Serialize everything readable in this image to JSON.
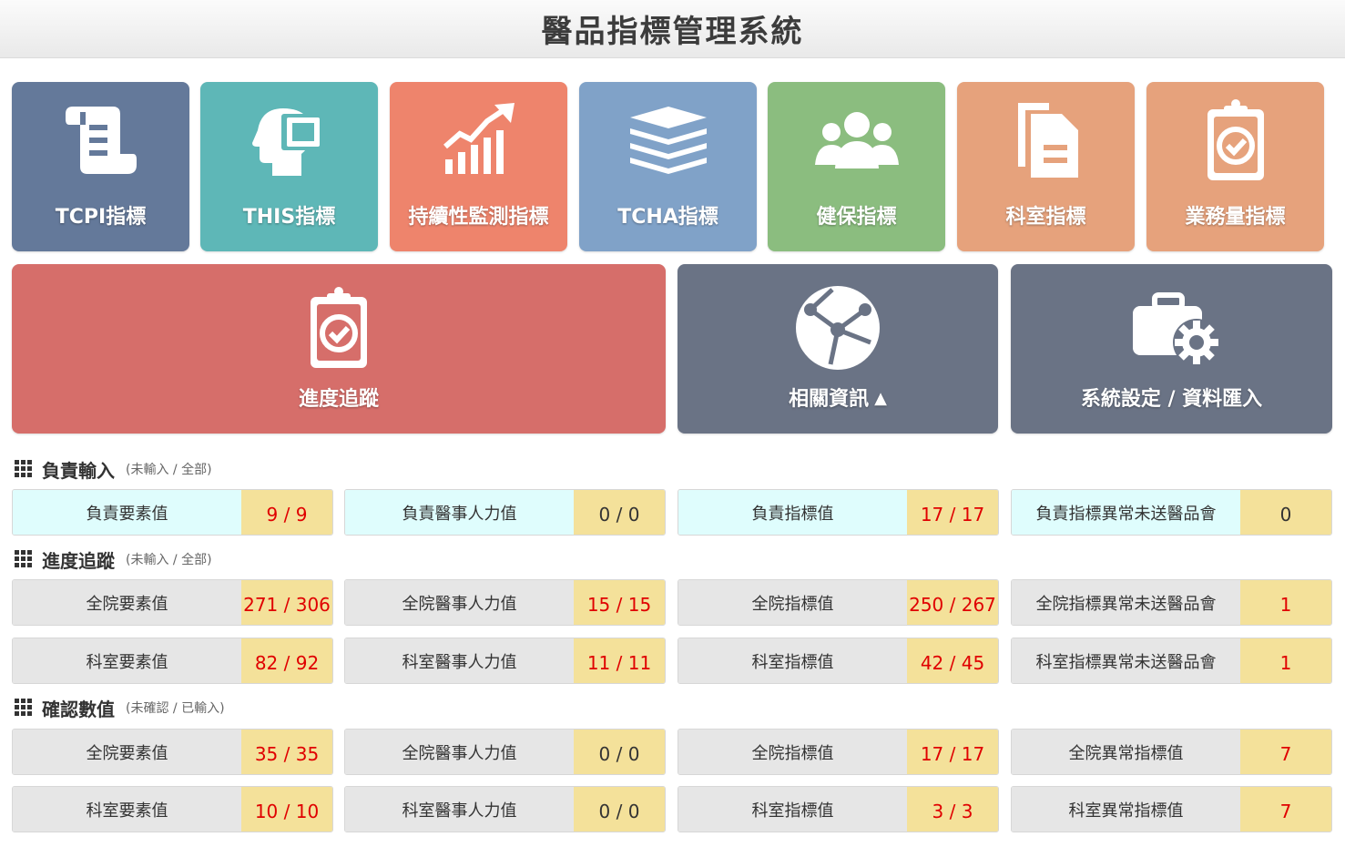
{
  "header": {
    "title": "醫品指標管理系統"
  },
  "tiles": {
    "tcpi": {
      "label": "TCPI指標",
      "color": "#64799a",
      "icon": "scroll-icon"
    },
    "this": {
      "label": "THIS指標",
      "color": "#5eb7b7",
      "icon": "head-profile-icon"
    },
    "sustain": {
      "label": "持續性監測指標",
      "color": "#ee846c",
      "icon": "chart-line-icon"
    },
    "tcha": {
      "label": "TCHA指標",
      "color": "#80a2c8",
      "icon": "layers-icon"
    },
    "nhi": {
      "label": "健保指標",
      "color": "#8bbd7f",
      "icon": "users-icon"
    },
    "dept": {
      "label": "科室指標",
      "color": "#e6a27c",
      "icon": "copy-file-icon"
    },
    "workload": {
      "label": "業務量指標",
      "color": "#e6a27c",
      "icon": "clipboard-check-icon"
    },
    "progress": {
      "label": "進度追蹤",
      "color": "#d66e6a",
      "icon": "clipboard-check-icon"
    },
    "related": {
      "label": "相關資訊",
      "color": "#6a7385",
      "icon": "globe-network-icon"
    },
    "settings": {
      "label": "系統設定 / 資料匯入",
      "color": "#6a7385",
      "icon": "briefcase-gear-icon"
    }
  },
  "sections": {
    "responsible": {
      "title": "負責輸入",
      "sub": "(未輸入 / 全部)",
      "items": [
        {
          "name": "負責要素值",
          "value": "9 / 9"
        },
        {
          "name": "負責醫事人力值",
          "value": "0 / 0"
        },
        {
          "name": "負責指標值",
          "value": "17 / 17"
        },
        {
          "name": "負責指標異常未送醫品會",
          "value": "0"
        }
      ]
    },
    "progress": {
      "title": "進度追蹤",
      "sub": "(未輸入 / 全部)",
      "items": [
        {
          "name": "全院要素值",
          "value": "271 / 306"
        },
        {
          "name": "全院醫事人力值",
          "value": "15 / 15"
        },
        {
          "name": "全院指標值",
          "value": "250 / 267"
        },
        {
          "name": "全院指標異常未送醫品會",
          "value": "1"
        },
        {
          "name": "科室要素值",
          "value": "82 / 92"
        },
        {
          "name": "科室醫事人力值",
          "value": "11 / 11"
        },
        {
          "name": "科室指標值",
          "value": "42 / 45"
        },
        {
          "name": "科室指標異常未送醫品會",
          "value": "1"
        }
      ]
    },
    "confirm": {
      "title": "確認數值",
      "sub": "(未確認 / 已輸入)",
      "items": [
        {
          "name": "全院要素值",
          "value": "35 / 35"
        },
        {
          "name": "全院醫事人力值",
          "value": "0 / 0"
        },
        {
          "name": "全院指標值",
          "value": "17 / 17"
        },
        {
          "name": "全院異常指標值",
          "value": "7"
        },
        {
          "name": "科室要素值",
          "value": "10 / 10"
        },
        {
          "name": "科室醫事人力值",
          "value": "0 / 0"
        },
        {
          "name": "科室指標值",
          "value": "3 / 3"
        },
        {
          "name": "科室異常指標值",
          "value": "7"
        }
      ]
    }
  }
}
